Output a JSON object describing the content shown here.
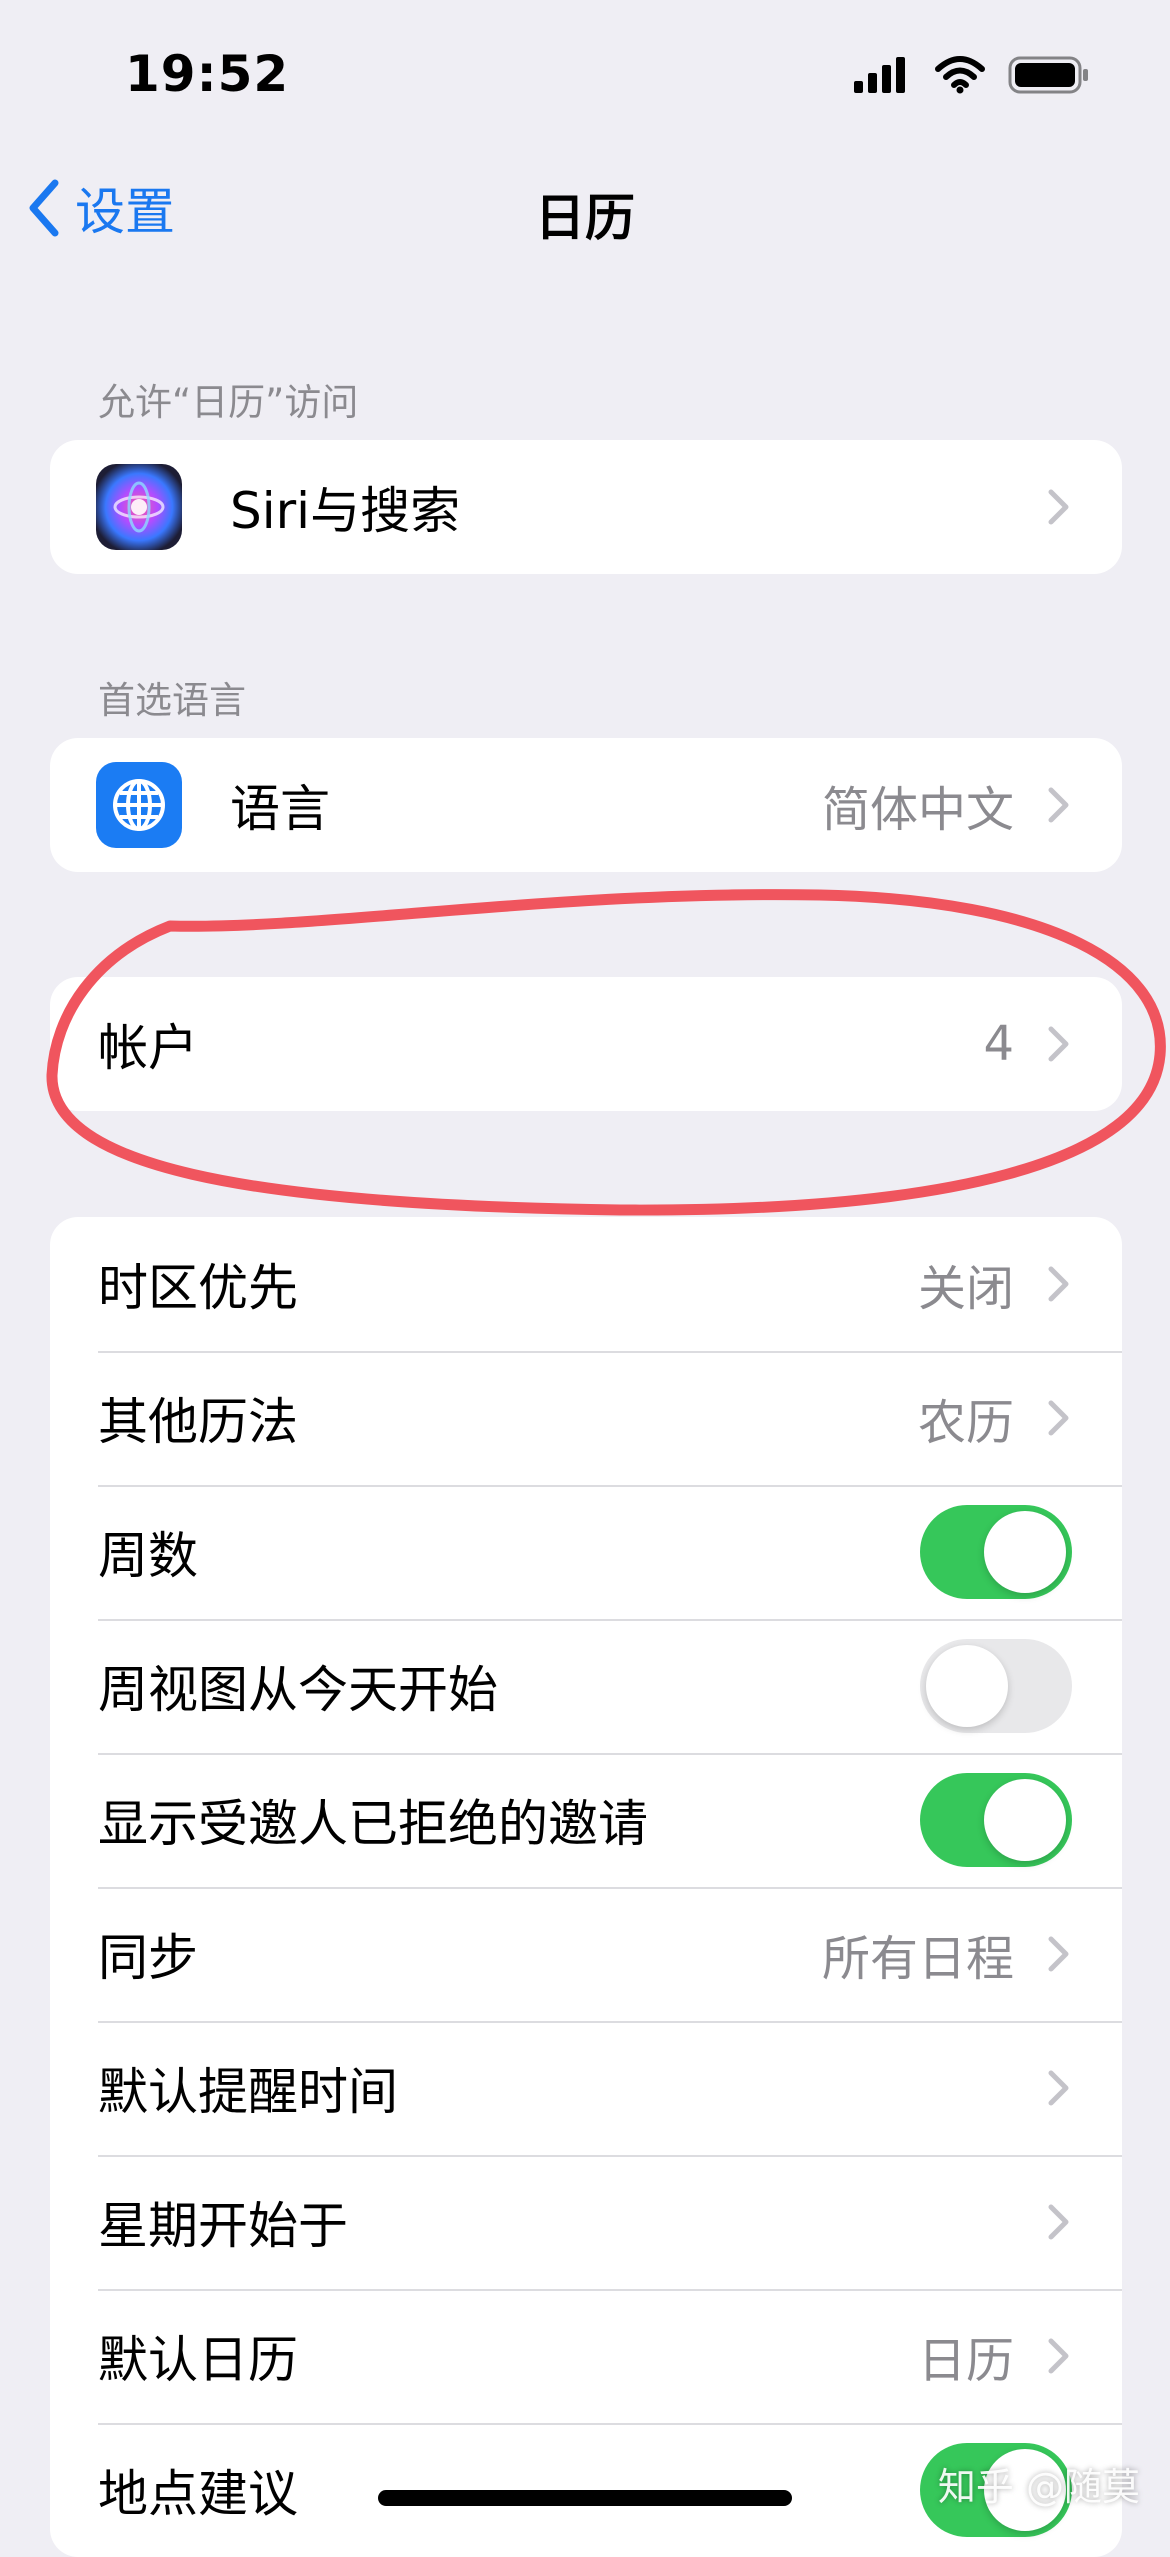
{
  "status_bar": {
    "time": "19:52"
  },
  "nav": {
    "back_label": "设置",
    "title": "日历"
  },
  "sections": {
    "access_header": "允许“日历”访问",
    "siri_label": "Siri与搜索",
    "language_header": "首选语言",
    "language_label": "语言",
    "language_value": "简体中文",
    "accounts_label": "帐户",
    "accounts_value": "4"
  },
  "settings": [
    {
      "label": "时区优先",
      "value": "关闭",
      "kind": "link"
    },
    {
      "label": "其他历法",
      "value": "农历",
      "kind": "link"
    },
    {
      "label": "周数",
      "value": "",
      "kind": "toggle",
      "on": true
    },
    {
      "label": "周视图从今天开始",
      "value": "",
      "kind": "toggle",
      "on": false
    },
    {
      "label": "显示受邀人已拒绝的邀请",
      "value": "",
      "kind": "toggle",
      "on": true
    },
    {
      "label": "同步",
      "value": "所有日程",
      "kind": "link"
    },
    {
      "label": "默认提醒时间",
      "value": "",
      "kind": "link"
    },
    {
      "label": "星期开始于",
      "value": "",
      "kind": "link"
    },
    {
      "label": "默认日历",
      "value": "日历",
      "kind": "link"
    },
    {
      "label": "地点建议",
      "value": "",
      "kind": "toggle",
      "on": true
    }
  ],
  "watermark": "知乎 @随莫",
  "colors": {
    "accent": "#1a78f0",
    "toggle_on": "#36c75a",
    "annotation": "#f0555e"
  }
}
